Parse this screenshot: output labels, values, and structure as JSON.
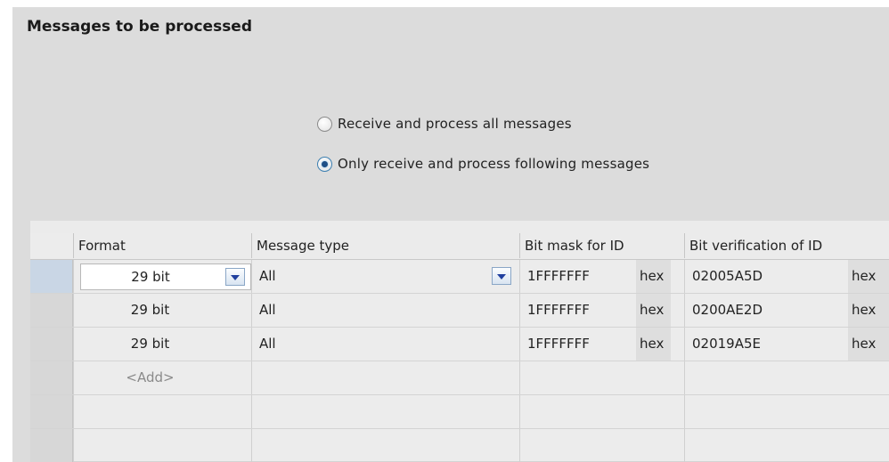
{
  "panel": {
    "title": "Messages to be processed"
  },
  "mode": {
    "options": [
      {
        "label": "Receive and process all messages",
        "checked": false
      },
      {
        "label": "Only receive and process following messages",
        "checked": true
      }
    ]
  },
  "table": {
    "columns": [
      "Format",
      "Message type",
      "Bit mask for ID",
      "Bit verification of ID"
    ],
    "rows": [
      {
        "format": "29 bit",
        "message_type": "All",
        "bit_mask": "1FFFFFFF",
        "bit_mask_unit": "hex",
        "bit_verification": "02005A5D",
        "bit_verification_unit": "hex"
      },
      {
        "format": "29 bit",
        "message_type": "All",
        "bit_mask": "1FFFFFFF",
        "bit_mask_unit": "hex",
        "bit_verification": "0200AE2D",
        "bit_verification_unit": "hex"
      },
      {
        "format": "29 bit",
        "message_type": "All",
        "bit_mask": "1FFFFFFF",
        "bit_mask_unit": "hex",
        "bit_verification": "02019A5E",
        "bit_verification_unit": "hex"
      }
    ],
    "add_label": "<Add>"
  }
}
